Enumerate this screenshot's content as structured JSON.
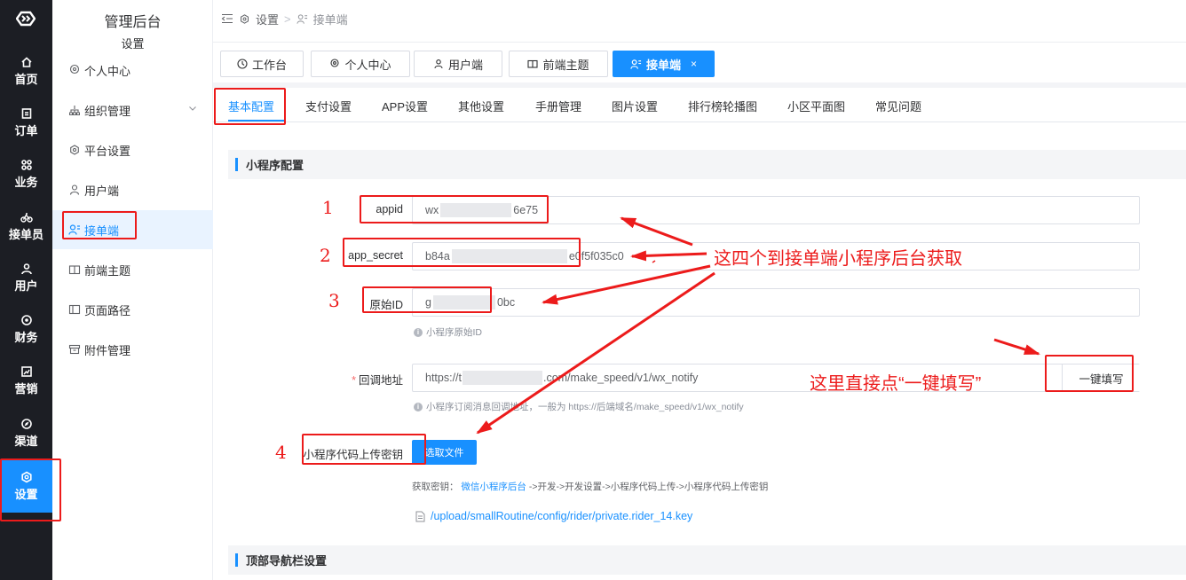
{
  "rail": {
    "items": [
      {
        "label": "首页",
        "icon": "home-icon"
      },
      {
        "label": "订单",
        "icon": "order-icon"
      },
      {
        "label": "业务",
        "icon": "command-icon"
      },
      {
        "label": "接单员",
        "icon": "bike-icon"
      },
      {
        "label": "用户",
        "icon": "user-icon"
      },
      {
        "label": "财务",
        "icon": "finance-icon"
      },
      {
        "label": "营销",
        "icon": "chart-icon"
      },
      {
        "label": "渠道",
        "icon": "compass-icon"
      },
      {
        "label": "设置",
        "icon": "gear-icon"
      }
    ],
    "active_index": 8,
    "active_color": "#1890ff"
  },
  "sidebar": {
    "title": "管理后台",
    "subtitle": "设置",
    "items": [
      {
        "label": "个人中心",
        "icon": "location-icon"
      },
      {
        "label": "组织管理",
        "icon": "org-icon"
      },
      {
        "label": "平台设置",
        "icon": "gear-icon"
      },
      {
        "label": "用户端",
        "icon": "user-icon"
      },
      {
        "label": "接单端",
        "icon": "rider-icon"
      },
      {
        "label": "前端主题",
        "icon": "book-icon"
      },
      {
        "label": "页面路径",
        "icon": "page-icon"
      },
      {
        "label": "附件管理",
        "icon": "box-icon"
      }
    ],
    "active_index": 4
  },
  "breadcrumb": {
    "level1": "设置",
    "sep": ">",
    "level2": "接单端"
  },
  "tags": [
    {
      "label": "工作台",
      "icon": "clock-icon"
    },
    {
      "label": "个人中心",
      "icon": "location-icon"
    },
    {
      "label": "用户端",
      "icon": "user-icon"
    },
    {
      "label": "前端主题",
      "icon": "book-icon"
    },
    {
      "label": "接单端",
      "icon": "rider-icon",
      "close": "×"
    }
  ],
  "tabs": [
    "基本配置",
    "支付设置",
    "APP设置",
    "其他设置",
    "手册管理",
    "图片设置",
    "排行榜轮播图",
    "小区平面图",
    "常见问题"
  ],
  "active_tab": 0,
  "sections": {
    "mini_program": "小程序配置",
    "top_nav": "顶部导航栏设置"
  },
  "form": {
    "appid": {
      "label": "appid",
      "value_start": "wx",
      "value_end": "6e75"
    },
    "app_secret": {
      "label": "app_secret",
      "value_start": "b84a",
      "value_end": "e0f5f035c0"
    },
    "original_id": {
      "label": "原始ID",
      "value_start": "g",
      "value_end": "0bc",
      "hint": "小程序原始ID"
    },
    "callback": {
      "label": "回调地址",
      "required_mark": "*",
      "value_start": "https://t",
      "value_end": ".com/make_speed/v1/wx_notify",
      "fill_button": "一键填写",
      "hint": "小程序订阅消息回调地址，一般为 https://后端域名/make_speed/v1/wx_notify"
    },
    "upload": {
      "label": "小程序代码上传密钥",
      "button": "选取文件",
      "acquire_prefix": "获取密钥：",
      "acquire_link": "微信小程序后台",
      "acquire_path": "->开发->开发设置->小程序代码上传->小程序代码上传密钥",
      "file": "/upload/smallRoutine/config/rider/private.rider_14.key"
    }
  },
  "annotations": {
    "numbers": [
      "1",
      "2",
      "3",
      "4"
    ],
    "text_main": "这四个到接单端小程序后台获取",
    "text_fill": "这里直接点“一键填写”",
    "color": "#ec1b1b"
  }
}
